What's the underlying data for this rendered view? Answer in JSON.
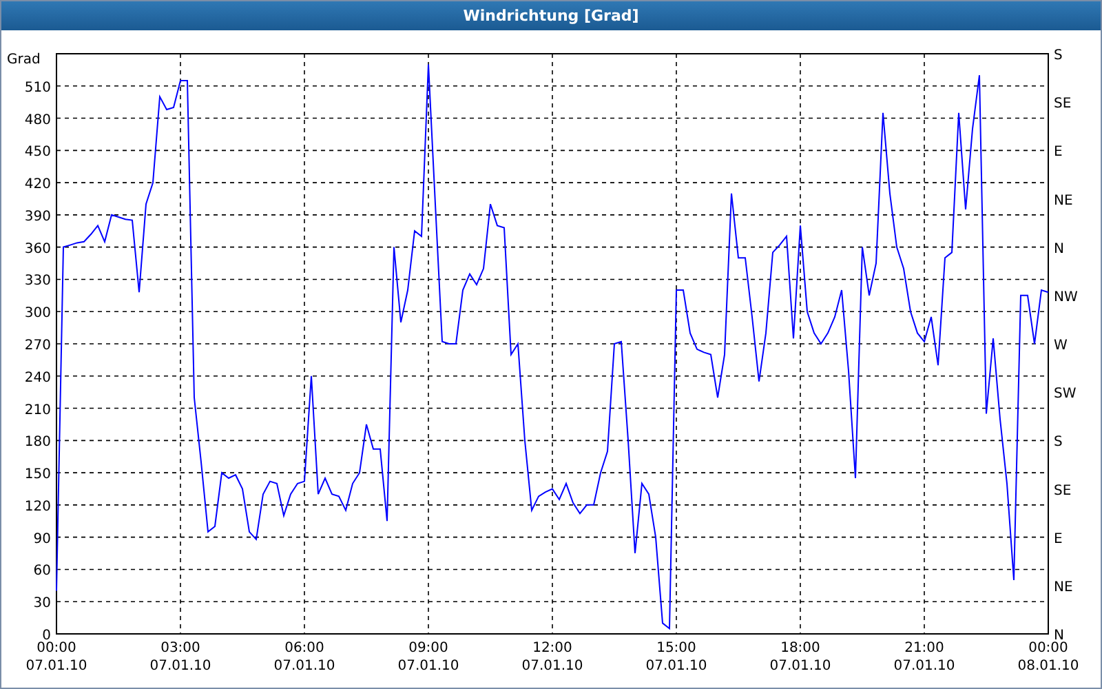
{
  "window": {
    "title": "Windrichtung [Grad]"
  },
  "chart": {
    "chart_data": {
      "type": "line",
      "grid": true,
      "ylabel": "Grad",
      "ylim": [
        0,
        540
      ],
      "categories": [
        "00:00\n07.01.10",
        null,
        null,
        null,
        null,
        null,
        null,
        null,
        null,
        null,
        null,
        null,
        null,
        null,
        null,
        null,
        null,
        null,
        "03:00\n07.01.10",
        null,
        null,
        null,
        null,
        null,
        null,
        null,
        null,
        null,
        null,
        null,
        null,
        null,
        null,
        null,
        null,
        null,
        "06:00\n07.01.10",
        null,
        null,
        null,
        null,
        null,
        null,
        null,
        null,
        null,
        null,
        null,
        null,
        null,
        null,
        null,
        null,
        null,
        "09:00\n07.01.10",
        null,
        null,
        null,
        null,
        null,
        null,
        null,
        null,
        null,
        null,
        null,
        null,
        null,
        null,
        null,
        null,
        null,
        "12:00\n07.01.10",
        null,
        null,
        null,
        null,
        null,
        null,
        null,
        null,
        null,
        null,
        null,
        null,
        null,
        null,
        null,
        null,
        null,
        "15:00\n07.01.10",
        null,
        null,
        null,
        null,
        null,
        null,
        null,
        null,
        null,
        null,
        null,
        null,
        null,
        null,
        null,
        null,
        null,
        "18:00\n07.01.10",
        null,
        null,
        null,
        null,
        null,
        null,
        null,
        null,
        null,
        null,
        null,
        null,
        null,
        null,
        null,
        null,
        null,
        "21:00\n07.01.10",
        null,
        null,
        null,
        null,
        null,
        null,
        null,
        null,
        null,
        null,
        null,
        null,
        null,
        null,
        null,
        null,
        null,
        "00:00\n08.01.10"
      ],
      "series": [
        {
          "color": "#0000ff",
          "values": [
            40,
            360,
            362,
            364,
            365,
            372,
            380,
            365,
            390,
            388,
            386,
            385,
            318,
            400,
            420,
            500,
            488,
            490,
            515,
            515,
            220,
            160,
            95,
            100,
            150,
            145,
            148,
            135,
            95,
            88,
            130,
            142,
            140,
            110,
            130,
            140,
            142,
            240,
            130,
            145,
            130,
            128,
            115,
            140,
            150,
            195,
            172,
            172,
            105,
            360,
            290,
            320,
            375,
            370,
            530,
            400,
            272,
            270,
            270,
            320,
            335,
            325,
            340,
            400,
            380,
            378,
            260,
            270,
            180,
            115,
            128,
            132,
            135,
            125,
            140,
            122,
            112,
            120,
            120,
            150,
            170,
            270,
            272,
            180,
            75,
            140,
            130,
            90,
            10,
            5,
            320,
            320,
            280,
            265,
            262,
            260,
            220,
            260,
            410,
            350,
            350,
            295,
            235,
            280,
            355,
            362,
            370,
            275,
            380,
            300,
            280,
            270,
            280,
            295,
            320,
            245,
            145,
            360,
            315,
            345,
            485,
            410,
            360,
            340,
            300,
            280,
            272,
            295,
            250,
            350,
            355,
            485,
            395,
            470,
            520,
            205,
            275,
            200,
            140,
            50,
            315,
            315,
            270,
            320,
            318
          ]
        }
      ],
      "yticks": [
        0,
        30,
        60,
        90,
        120,
        150,
        180,
        210,
        240,
        270,
        300,
        330,
        360,
        390,
        420,
        450,
        480,
        510
      ]
    },
    "compass_labels": [
      "S",
      "SE",
      "E",
      "NE",
      "N",
      "NW",
      "W",
      "SW",
      "S",
      "SE",
      "E",
      "NE",
      "N"
    ]
  }
}
